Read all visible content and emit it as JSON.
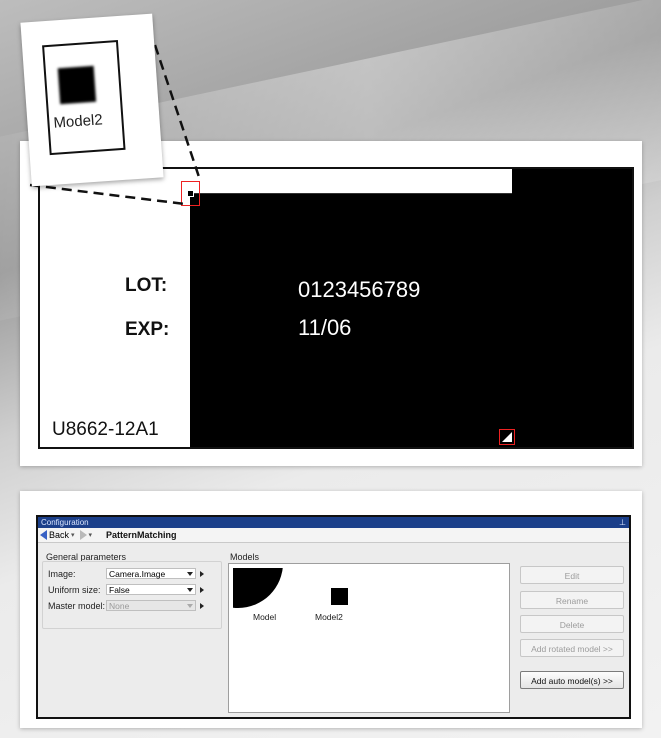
{
  "label": {
    "lot_label": "LOT:",
    "lot_value": "0123456789",
    "exp_label": "EXP:",
    "exp_value": "11/06",
    "code": "U8662-12A1",
    "zoom_caption": "Model2"
  },
  "window": {
    "title": "Configuration",
    "nav": {
      "back_label": "Back",
      "breadcrumb": "PatternMatching"
    },
    "general_parameters": {
      "title": "General parameters",
      "rows": [
        {
          "label": "Image:",
          "value": "Camera.Image",
          "enabled": true
        },
        {
          "label": "Uniform size:",
          "value": "False",
          "enabled": true
        },
        {
          "label": "Master model:",
          "value": "None",
          "enabled": false
        }
      ]
    },
    "models": {
      "title": "Models",
      "items": [
        {
          "name": "Model"
        },
        {
          "name": "Model2"
        }
      ]
    },
    "buttons": {
      "edit": "Edit",
      "rename": "Rename",
      "delete": "Delete",
      "add_rotated": "Add rotated model >>",
      "add_auto": "Add auto model(s) >>"
    }
  },
  "colors": {
    "titlebar": "#1b3f8a",
    "marker": "#e22222",
    "nav_arrow": "#3760c4"
  },
  "icons": [
    "arrow-left-icon",
    "arrow-right-icon",
    "dropdown-icon",
    "expand-icon",
    "pin-icon"
  ]
}
